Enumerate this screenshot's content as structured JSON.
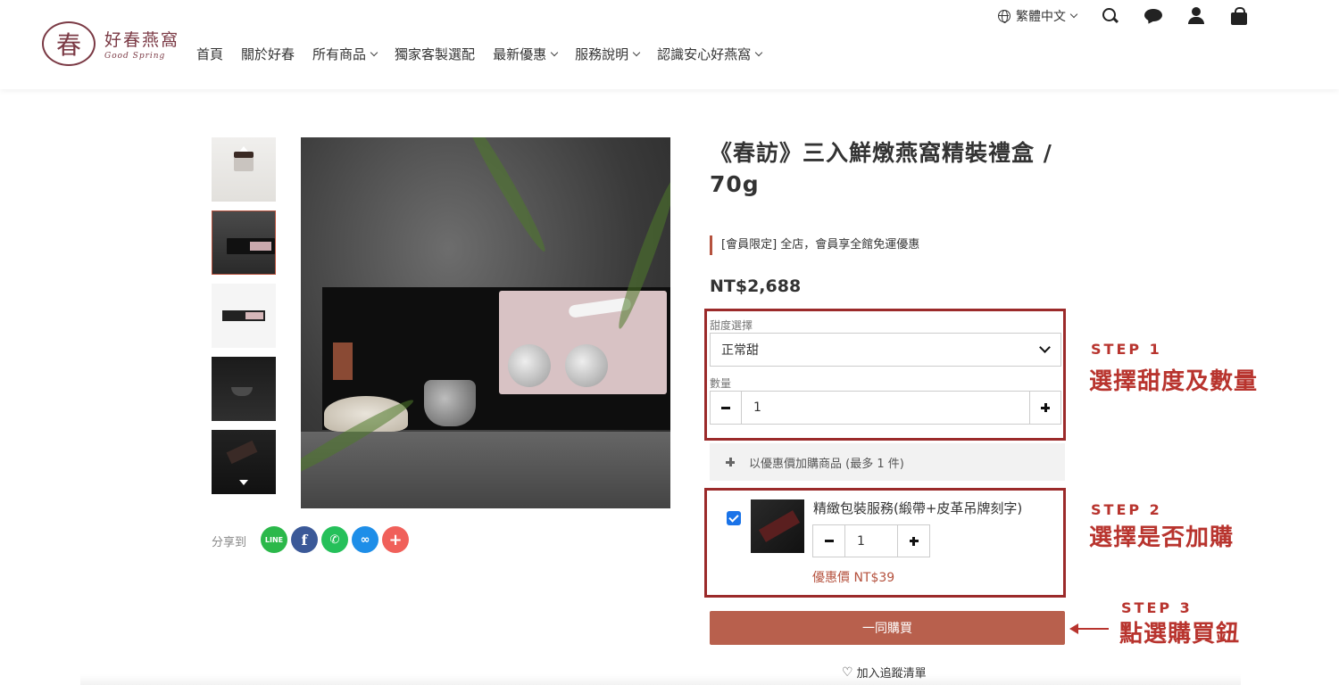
{
  "header": {
    "logo": {
      "cn": "好春燕窩",
      "en": "Good Spring",
      "mark": "春"
    },
    "nav": [
      {
        "label": "首頁",
        "dropdown": false
      },
      {
        "label": "關於好春",
        "dropdown": false
      },
      {
        "label": "所有商品",
        "dropdown": true
      },
      {
        "label": "獨家客製選配",
        "dropdown": false
      },
      {
        "label": "最新優惠",
        "dropdown": true
      },
      {
        "label": "服務說明",
        "dropdown": true
      },
      {
        "label": "認識安心好燕窩",
        "dropdown": true
      }
    ],
    "language": "繁體中文",
    "icons": [
      "search-icon",
      "chat-icon",
      "user-icon",
      "bag-icon"
    ]
  },
  "gallery": {
    "share_label": "分享到",
    "share_buttons": [
      "LINE",
      "f",
      "whatsapp",
      "link",
      "+"
    ]
  },
  "product": {
    "title": "《春訪》三入鮮燉燕窩精裝禮盒 / 70g",
    "promo": "[會員限定] 全店，會員享全館免運優惠",
    "price": "NT$2,688",
    "sweetness_label": "甜度選擇",
    "sweetness_value": "正常甜",
    "quantity_label": "數量",
    "quantity_value": "1",
    "addon_bar": "以優惠價加購商品 (最多 1 件)",
    "addon": {
      "name": "精緻包裝服務(緞帶+皮革吊牌刻字)",
      "quantity": "1",
      "price": "優惠價 NT$39",
      "checked": true
    },
    "buy_button": "一同購買",
    "wishlist": "加入追蹤清單"
  },
  "steps": [
    {
      "title": "STEP 1",
      "desc": "選擇甜度及數量"
    },
    {
      "title": "STEP 2",
      "desc": "選擇是否加購"
    },
    {
      "title": "STEP 3",
      "desc": "點選購買鈕"
    }
  ],
  "colors": {
    "accent": "#b8604d",
    "annotation": "#9b2a2a",
    "brand": "#7b3a45"
  }
}
